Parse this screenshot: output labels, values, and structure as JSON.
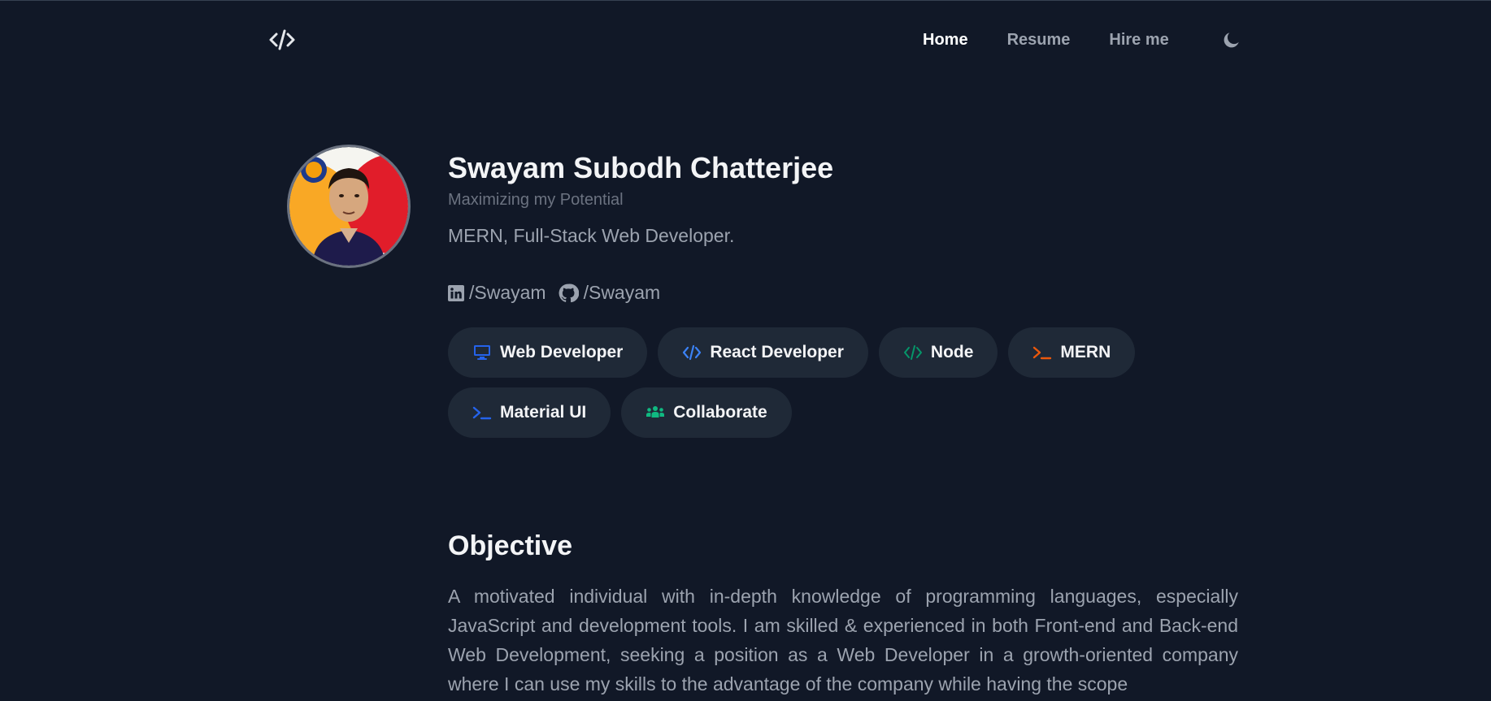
{
  "nav": {
    "logo_icon": "code-brackets-icon",
    "links": [
      {
        "label": "Home",
        "active": true
      },
      {
        "label": "Resume",
        "active": false
      },
      {
        "label": "Hire me",
        "active": false
      }
    ],
    "theme_icon": "moon-icon"
  },
  "profile": {
    "name": "Swayam Subodh Chatterjee",
    "tagline": "Maximizing my Potential",
    "role": "MERN, Full-Stack Web Developer.",
    "socials": [
      {
        "icon": "linkedin-icon",
        "label": "/Swayam"
      },
      {
        "icon": "github-icon",
        "label": "/Swayam"
      }
    ]
  },
  "skills": [
    {
      "label": "Web Developer",
      "icon": "monitor-icon",
      "color": "#2563eb"
    },
    {
      "label": "React Developer",
      "icon": "code-icon",
      "color": "#3b82f6"
    },
    {
      "label": "Node",
      "icon": "code-icon",
      "color": "#059669"
    },
    {
      "label": "MERN",
      "icon": "terminal-icon",
      "color": "#ea580c"
    },
    {
      "label": "Material UI",
      "icon": "terminal-icon",
      "color": "#2563eb"
    },
    {
      "label": "Collaborate",
      "icon": "users-icon",
      "color": "#10b981"
    }
  ],
  "objective": {
    "title": "Objective",
    "text": "A motivated individual with in-depth knowledge of programming languages, especially JavaScript and development tools. I am skilled & experienced in both Front-end and Back-end Web Development, seeking a position as a Web Developer in a growth-oriented company where I can use my skills to the advantage of the company while having the scope"
  },
  "colors": {
    "background": "#111827",
    "chip_bg": "#1f2937",
    "muted_text": "#9ca3af"
  }
}
